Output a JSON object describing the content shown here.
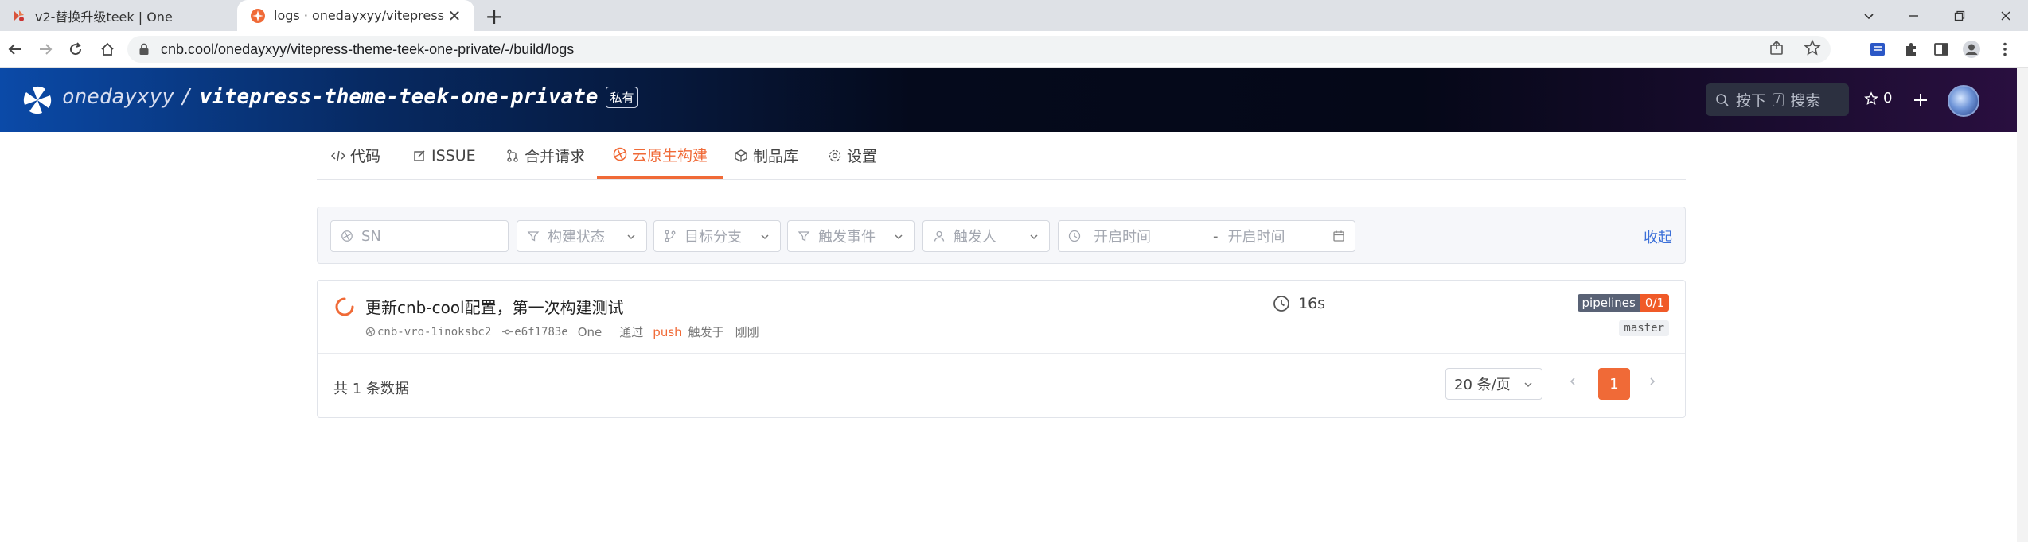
{
  "browser": {
    "tabs": [
      {
        "title": "v2-替换升级teek | One",
        "active": false
      },
      {
        "title": "logs · onedayxyy/vitepress-the",
        "active": true
      }
    ],
    "url": "cnb.cool/onedayxyy/vitepress-theme-teek-one-private/-/build/logs"
  },
  "header": {
    "owner": "onedayxyy",
    "separator": "/",
    "repo": "vitepress-theme-teek-one-private",
    "visibility_badge": "私有",
    "search_prefix": "按下",
    "search_key": "/",
    "search_suffix": "搜索",
    "star_count": "0"
  },
  "repo_nav": [
    {
      "label": "代码",
      "icon": "code-icon",
      "active": false
    },
    {
      "label": "ISSUE",
      "icon": "issue-icon",
      "active": false
    },
    {
      "label": "合并请求",
      "icon": "merge-request-icon",
      "active": false
    },
    {
      "label": "云原生构建",
      "icon": "build-icon",
      "active": true
    },
    {
      "label": "制品库",
      "icon": "package-icon",
      "active": false
    },
    {
      "label": "设置",
      "icon": "settings-icon",
      "active": false
    }
  ],
  "filters": {
    "sn_placeholder": "SN",
    "build_status": "构建状态",
    "target_branch": "目标分支",
    "trigger_event": "触发事件",
    "trigger_user": "触发人",
    "start_time_from": "开启时间",
    "range_sep": "-",
    "start_time_to": "开启时间",
    "collapse_label": "收起"
  },
  "builds": [
    {
      "title": "更新cnb-cool配置，第一次构建测试",
      "sn": "cnb-vro-1inoksbc2",
      "commit": "e6f1783e",
      "author": "One",
      "via": "通过",
      "event": "push",
      "triggered": "触发于",
      "time": "刚刚",
      "duration": "16s",
      "pipelines_label": "pipelines",
      "pipelines_count": "0/1",
      "branch": "master"
    }
  ],
  "pagination": {
    "total_text": "共 1 条数据",
    "page_size": "20 条/页",
    "current_page": "1"
  },
  "colors": {
    "accent": "#f06a37",
    "link": "#3b6fd8"
  }
}
